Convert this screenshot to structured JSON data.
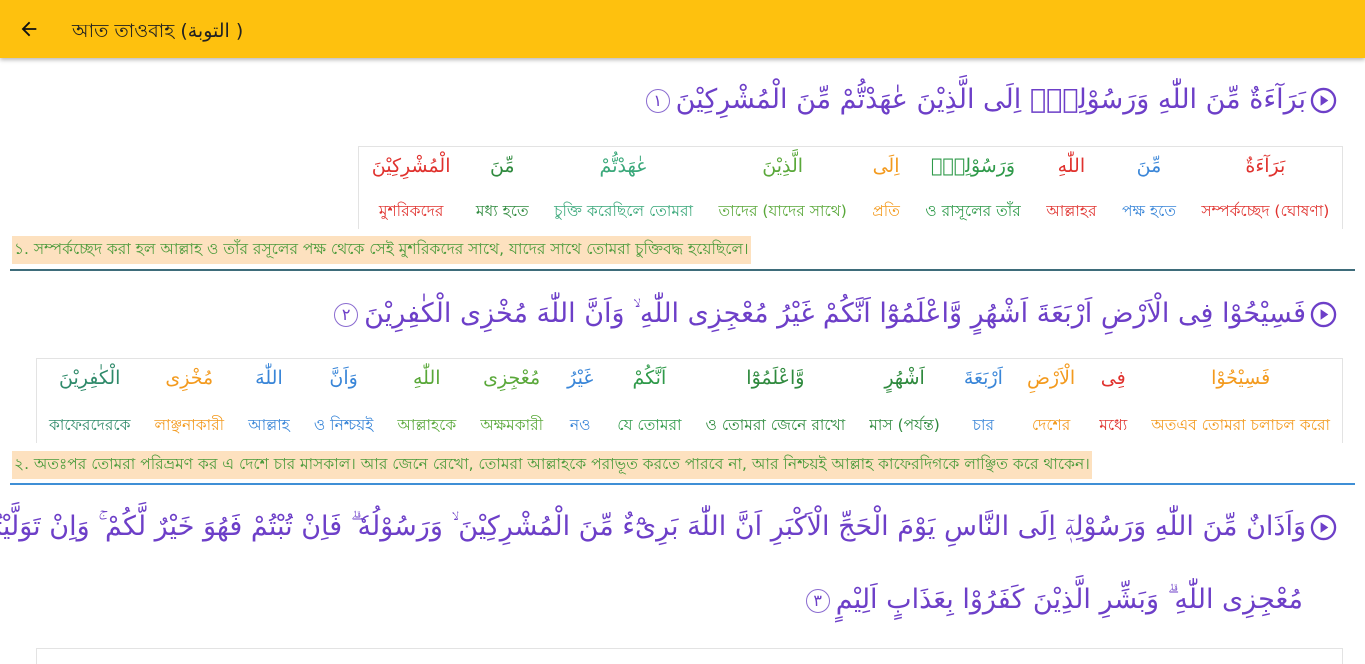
{
  "app_bar": {
    "title": "আত তাওবাহ (التوبة )",
    "back_icon": "arrow-left-icon",
    "background": "#fec10e"
  },
  "colors": {
    "arabic_main": "#6d3fc8",
    "translation_text": "#4a9a3a",
    "translation_bg": "#fde1bf",
    "divider_1": "#3e6c7a",
    "divider_2": "#3f8fd6"
  },
  "ayahs": [
    {
      "number": "١",
      "arabic": "بَرَآءَةٌ مِّنَ اللّٰهِ وَرَسُوْلِهٖٓ اِلَى الَّذِيْنَ عٰهَدْتُّمْ مِّنَ الْمُشْرِكِيْنَ",
      "words": [
        {
          "ar": "بَرَآءَةٌ",
          "bn": "সম্পর্কচ্ছেদ (ঘোষণা)",
          "color": "#e0322e"
        },
        {
          "ar": "مِّنَ",
          "bn": "পক্ষ হতে",
          "color": "#3a86d8"
        },
        {
          "ar": "اللّٰهِ",
          "bn": "আল্লাহর",
          "color": "#e0322e"
        },
        {
          "ar": "وَرَسُوْلِهٖٓ",
          "bn": "ও রাসূলের তাঁর",
          "color": "#2f9a4a"
        },
        {
          "ar": "اِلَى",
          "bn": "প্রতি",
          "color": "#f39a1e"
        },
        {
          "ar": "الَّذِيْنَ",
          "bn": "তাদের (যাদের সাথে)",
          "color": "#5aa83a"
        },
        {
          "ar": "عٰهَدْتُّمْ",
          "bn": "চুক্তি করেছিলে তোমরা",
          "color": "#3aa87a"
        },
        {
          "ar": "مِّنَ",
          "bn": "মধ্য হতে",
          "color": "#2f8a3e"
        },
        {
          "ar": "الْمُشْرِكِيْنَ",
          "bn": "মুশরিকদের",
          "color": "#e0322e"
        }
      ],
      "translation": "১. সম্পর্কচ্ছেদ করা হল আল্লাহ ও তাঁর রসূলের পক্ষ থেকে সেই মুশরিকদের সাথে, যাদের সাথে তোমরা চুক্তিবদ্ধ হয়েছিলে।"
    },
    {
      "number": "٢",
      "arabic": "فَسِيْحُوْا فِى الْاَرْضِ اَرْبَعَةَ اَشْهُرٍ وَّاعْلَمُوْٓا اَنَّكُمْ غَيْرُ مُعْجِزِى اللّٰهِ ۙ وَاَنَّ اللّٰهَ مُخْزِى الْكٰفِرِيْنَ",
      "words": [
        {
          "ar": "فَسِيْحُوْا",
          "bn": "অতএব তোমরা চলাচল করো",
          "color": "#f39a1e"
        },
        {
          "ar": "فِى",
          "bn": "মধ্যে",
          "color": "#e0322e"
        },
        {
          "ar": "الْاَرْضِ",
          "bn": "দেশের",
          "color": "#f39a1e"
        },
        {
          "ar": "اَرْبَعَةَ",
          "bn": "চার",
          "color": "#3a86d8"
        },
        {
          "ar": "اَشْهُرٍ",
          "bn": "মাস (পর্যন্ত)",
          "color": "#2f8a3e"
        },
        {
          "ar": "وَّاعْلَمُوْٓا",
          "bn": "ও তোমরা জেনে রাখো",
          "color": "#2f8a3e"
        },
        {
          "ar": "اَنَّكُمْ",
          "bn": "যে তোমরা",
          "color": "#2f9a4a"
        },
        {
          "ar": "غَيْرُ",
          "bn": "নও",
          "color": "#3a86d8"
        },
        {
          "ar": "مُعْجِزِى",
          "bn": "অক্ষমকারী",
          "color": "#5aa83a"
        },
        {
          "ar": "اللّٰهِ",
          "bn": "আল্লাহকে",
          "color": "#5aa83a"
        },
        {
          "ar": "وَاَنَّ",
          "bn": "ও নিশ্চয়ই",
          "color": "#3a86d8"
        },
        {
          "ar": "اللّٰهَ",
          "bn": "আল্লাহ",
          "color": "#3a86d8"
        },
        {
          "ar": "مُخْزِى",
          "bn": "লাঞ্ছনাকারী",
          "color": "#f39a1e"
        },
        {
          "ar": "الْكٰفِرِيْنَ",
          "bn": "কাফেরদেরকে",
          "color": "#2f8a6a"
        }
      ],
      "translation": "২. অতঃপর তোমরা পরিভ্রমণ কর এ দেশে চার মাসকাল। আর জেনে রেখো, তোমরা আল্লাহকে পরাভূত করতে পারবে না, আর নিশ্চয়ই আল্লাহ কাফেরদিগকে লাঞ্ছিত করে থাকেন।"
    },
    {
      "number": "٣",
      "arabic_line1": "وَاَذَانٌ مِّنَ اللّٰهِ وَرَسُوْلِهٖٓ اِلَى النَّاسِ يَوْمَ الْحَجِّ الْاَكْبَرِ اَنَّ اللّٰهَ بَرِىْٓءٌ مِّنَ الْمُشْرِكِيْنَ ۙ وَرَسُوْلُهٗ ۗ فَاِنْ تُبْتُمْ فَهُوَ خَيْرٌ لَّكُمْ ۚ وَاِنْ تَوَلَّيْتُمْ فَاعْلَمُوْٓا اَنَّكُمْ غَيْرُ",
      "arabic_line2": "مُعْجِزِى اللّٰهِ ۗ وَبَشِّرِ الَّذِيْنَ كَفَرُوْا بِعَذَابٍ اَلِيْمٍ"
    }
  ]
}
